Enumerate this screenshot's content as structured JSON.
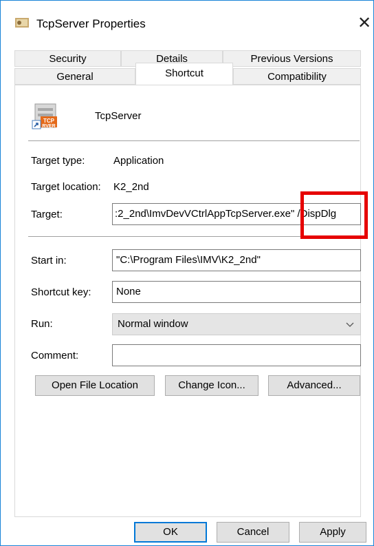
{
  "window": {
    "title": "TcpServer Properties",
    "close_glyph": "✕"
  },
  "tabs_row1": [
    "Security",
    "Details",
    "Previous Versions"
  ],
  "tabs_row2": [
    "General",
    "Shortcut",
    "Compatibility"
  ],
  "selected_tab": "Shortcut",
  "shortcut": {
    "name": "TcpServer",
    "icon_text": "TCP RVER",
    "target_type_label": "Target type:",
    "target_type_value": "Application",
    "target_location_label": "Target location:",
    "target_location_value": "K2_2nd",
    "target_label": "Target:",
    "target_value": ":2_2nd\\ImvDevVCtrlAppTcpServer.exe\" /DispDlg",
    "start_in_label": "Start in:",
    "start_in_value": "\"C:\\Program Files\\IMV\\K2_2nd\"",
    "shortcut_key_label": "Shortcut key:",
    "shortcut_key_value": "None",
    "run_label": "Run:",
    "run_value": "Normal window",
    "comment_label": "Comment:",
    "comment_value": ""
  },
  "buttons": {
    "open_file_location": "Open File Location",
    "change_icon": "Change Icon...",
    "advanced": "Advanced...",
    "ok": "OK",
    "cancel": "Cancel",
    "apply": "Apply"
  },
  "colors": {
    "highlight": "#e60000",
    "accent": "#0078d7"
  }
}
